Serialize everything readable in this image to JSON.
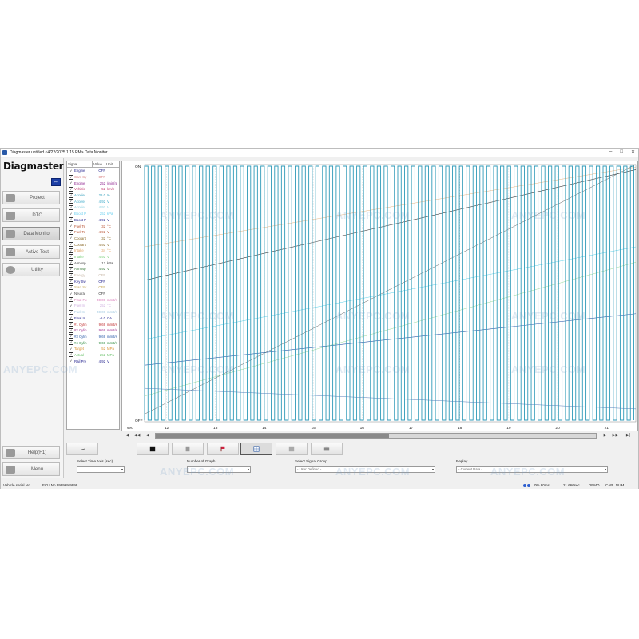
{
  "window": {
    "title": "Diagmaster untitled <4/22/2025 1:15 PM> Data Monitor",
    "controls": {
      "minimize": "–",
      "maximize": "□",
      "close": "✕"
    }
  },
  "sidebar": {
    "logo": "Diagmaster",
    "swap_icon": "⇔",
    "nav": [
      {
        "label": "Project",
        "icon": "project-icon"
      },
      {
        "label": "DTC",
        "icon": "dtc-icon"
      },
      {
        "label": "Data Monitor",
        "icon": "data-monitor-icon"
      },
      {
        "label": "Active Test",
        "icon": "active-test-icon"
      },
      {
        "label": "Utility",
        "icon": "gear-icon"
      }
    ],
    "help_label": "Help(F1)",
    "menu_label": "Menu"
  },
  "signal_table": {
    "headers": {
      "signal": "Signal",
      "value": "Value",
      "unit": "Unit"
    },
    "rows": [
      {
        "name": "Engine",
        "value": "OFF",
        "unit": "",
        "color": "#1a1a8a"
      },
      {
        "name": "Cam Sy",
        "value": "OFF",
        "unit": "",
        "color": "#d98080"
      },
      {
        "name": "Engine",
        "value": "252",
        "unit": "/min(rp",
        "color": "#8a1a8a"
      },
      {
        "name": "Vehicle",
        "value": "52",
        "unit": "km/h",
        "color": "#c0306a"
      },
      {
        "name": "Accelei",
        "value": "26.0",
        "unit": "%",
        "color": "#2a9ab8"
      },
      {
        "name": "Accelei",
        "value": "4.92",
        "unit": "V",
        "color": "#38a8c8"
      },
      {
        "name": "Accelei",
        "value": "4.92",
        "unit": "V",
        "color": "#8ad0e0"
      },
      {
        "name": "Boost P",
        "value": "252",
        "unit": "kPa",
        "color": "#6ad0f0"
      },
      {
        "name": "Boost P",
        "value": "4.92",
        "unit": "V",
        "color": "#1a1a8a"
      },
      {
        "name": "Fuel Te",
        "value": "32",
        "unit": "°C",
        "color": "#b85030"
      },
      {
        "name": "Fuel Te",
        "value": "4.92",
        "unit": "V",
        "color": "#b85030"
      },
      {
        "name": "Coolant",
        "value": "32",
        "unit": "°C",
        "color": "#8a6a2a"
      },
      {
        "name": "Coolant",
        "value": "4.92",
        "unit": "V",
        "color": "#8a6a2a"
      },
      {
        "name": "Intake",
        "value": "34",
        "unit": "°C",
        "color": "#e0a060"
      },
      {
        "name": "Intake",
        "value": "4.92",
        "unit": "V",
        "color": "#7ad07a"
      },
      {
        "name": "Atmosp",
        "value": "12",
        "unit": "kPa",
        "color": "#3a3a3a"
      },
      {
        "name": "Atmosp",
        "value": "4.92",
        "unit": "V",
        "color": "#3a7a3a"
      },
      {
        "name": "Energy",
        "value": "OFF",
        "unit": "",
        "color": "#c8b8a8"
      },
      {
        "name": "Key Sw",
        "value": "OFF",
        "unit": "",
        "color": "#1a1a8a"
      },
      {
        "name": "Start Sv",
        "value": "OFF",
        "unit": "",
        "color": "#c8a858"
      },
      {
        "name": "Neutral",
        "value": "OFF",
        "unit": "",
        "color": "#3a3a3a"
      },
      {
        "name": "Final Fu",
        "value": "49.00",
        "unit": "mm3/s",
        "color": "#d878b8"
      },
      {
        "name": "Fuel Inj",
        "value": "252",
        "unit": "°C",
        "color": "#d0b0e0"
      },
      {
        "name": "Fuel Inj",
        "value": "49.00",
        "unit": "mm3/s",
        "color": "#a0c8e0"
      },
      {
        "name": "Final In",
        "value": "-5.0",
        "unit": "CA",
        "color": "#1a1a8a"
      },
      {
        "name": "#1 Cylin",
        "value": "9.69",
        "unit": "mm3/s",
        "color": "#c03030"
      },
      {
        "name": "#2 Cylin",
        "value": "9.69",
        "unit": "mm3/s",
        "color": "#a03090"
      },
      {
        "name": "#3 Cylin",
        "value": "9.69",
        "unit": "mm3/s",
        "color": "#2a5aa8"
      },
      {
        "name": "#4 Cylin",
        "value": "9.69",
        "unit": "mm3/s",
        "color": "#2a8a3a"
      },
      {
        "name": "Target",
        "value": "52",
        "unit": "MPa",
        "color": "#d89030"
      },
      {
        "name": "Actual I",
        "value": "252",
        "unit": "MPa",
        "color": "#6ac06a"
      },
      {
        "name": "Rail Pre",
        "value": "4.92",
        "unit": "V",
        "color": "#1a1a8a"
      }
    ]
  },
  "graph": {
    "y_top_label": "ON",
    "y_bottom_label": "OFF",
    "x_unit_label": "sec",
    "x_ticks": [
      "12",
      "13",
      "14",
      "15",
      "16",
      "17",
      "18",
      "19",
      "20",
      "21"
    ],
    "x_range": [
      11.55,
      21.6
    ],
    "pulse_period_sec": 0.14,
    "series_colors": {
      "pulse": "#2e9ab8",
      "ramp_dark": "#3a3a3a",
      "ramp_blue": "#2a5aa8",
      "ramp_cyan": "#5ad0e8",
      "ramp_orange": "#e0a060",
      "ramp_green": "#7ad07a"
    }
  },
  "scroll": {
    "buttons": {
      "first": "|◀",
      "prev_fast": "◀◀",
      "prev": "◀",
      "next": "▶",
      "next_fast": "▶▶",
      "last": "▶|"
    },
    "position": 0.53
  },
  "toolbar": {
    "buttons": [
      "record-icon",
      "copy-icon",
      "flag-icon",
      "grid-graph-icon",
      "save-icon",
      "print-icon"
    ]
  },
  "controls": {
    "time_axis": {
      "label": "Select Time Axis (sec)",
      "value": ""
    },
    "num_graph": {
      "label": "Number of Graph",
      "value": ""
    },
    "signal_group": {
      "label": "Select Signal Group",
      "value": "- User Defined -"
    },
    "replay": {
      "label": "Replay",
      "value": "- Current Data -"
    }
  },
  "status": {
    "serial": "Vehicle serial No.",
    "ecu": "ECU No.999999-9999",
    "rate": "0% 80ms",
    "elapsed": "21.666sec",
    "mode": "DEMO",
    "caps": "CAP",
    "num": "NUM"
  },
  "watermark": "ANYEPC.COM"
}
